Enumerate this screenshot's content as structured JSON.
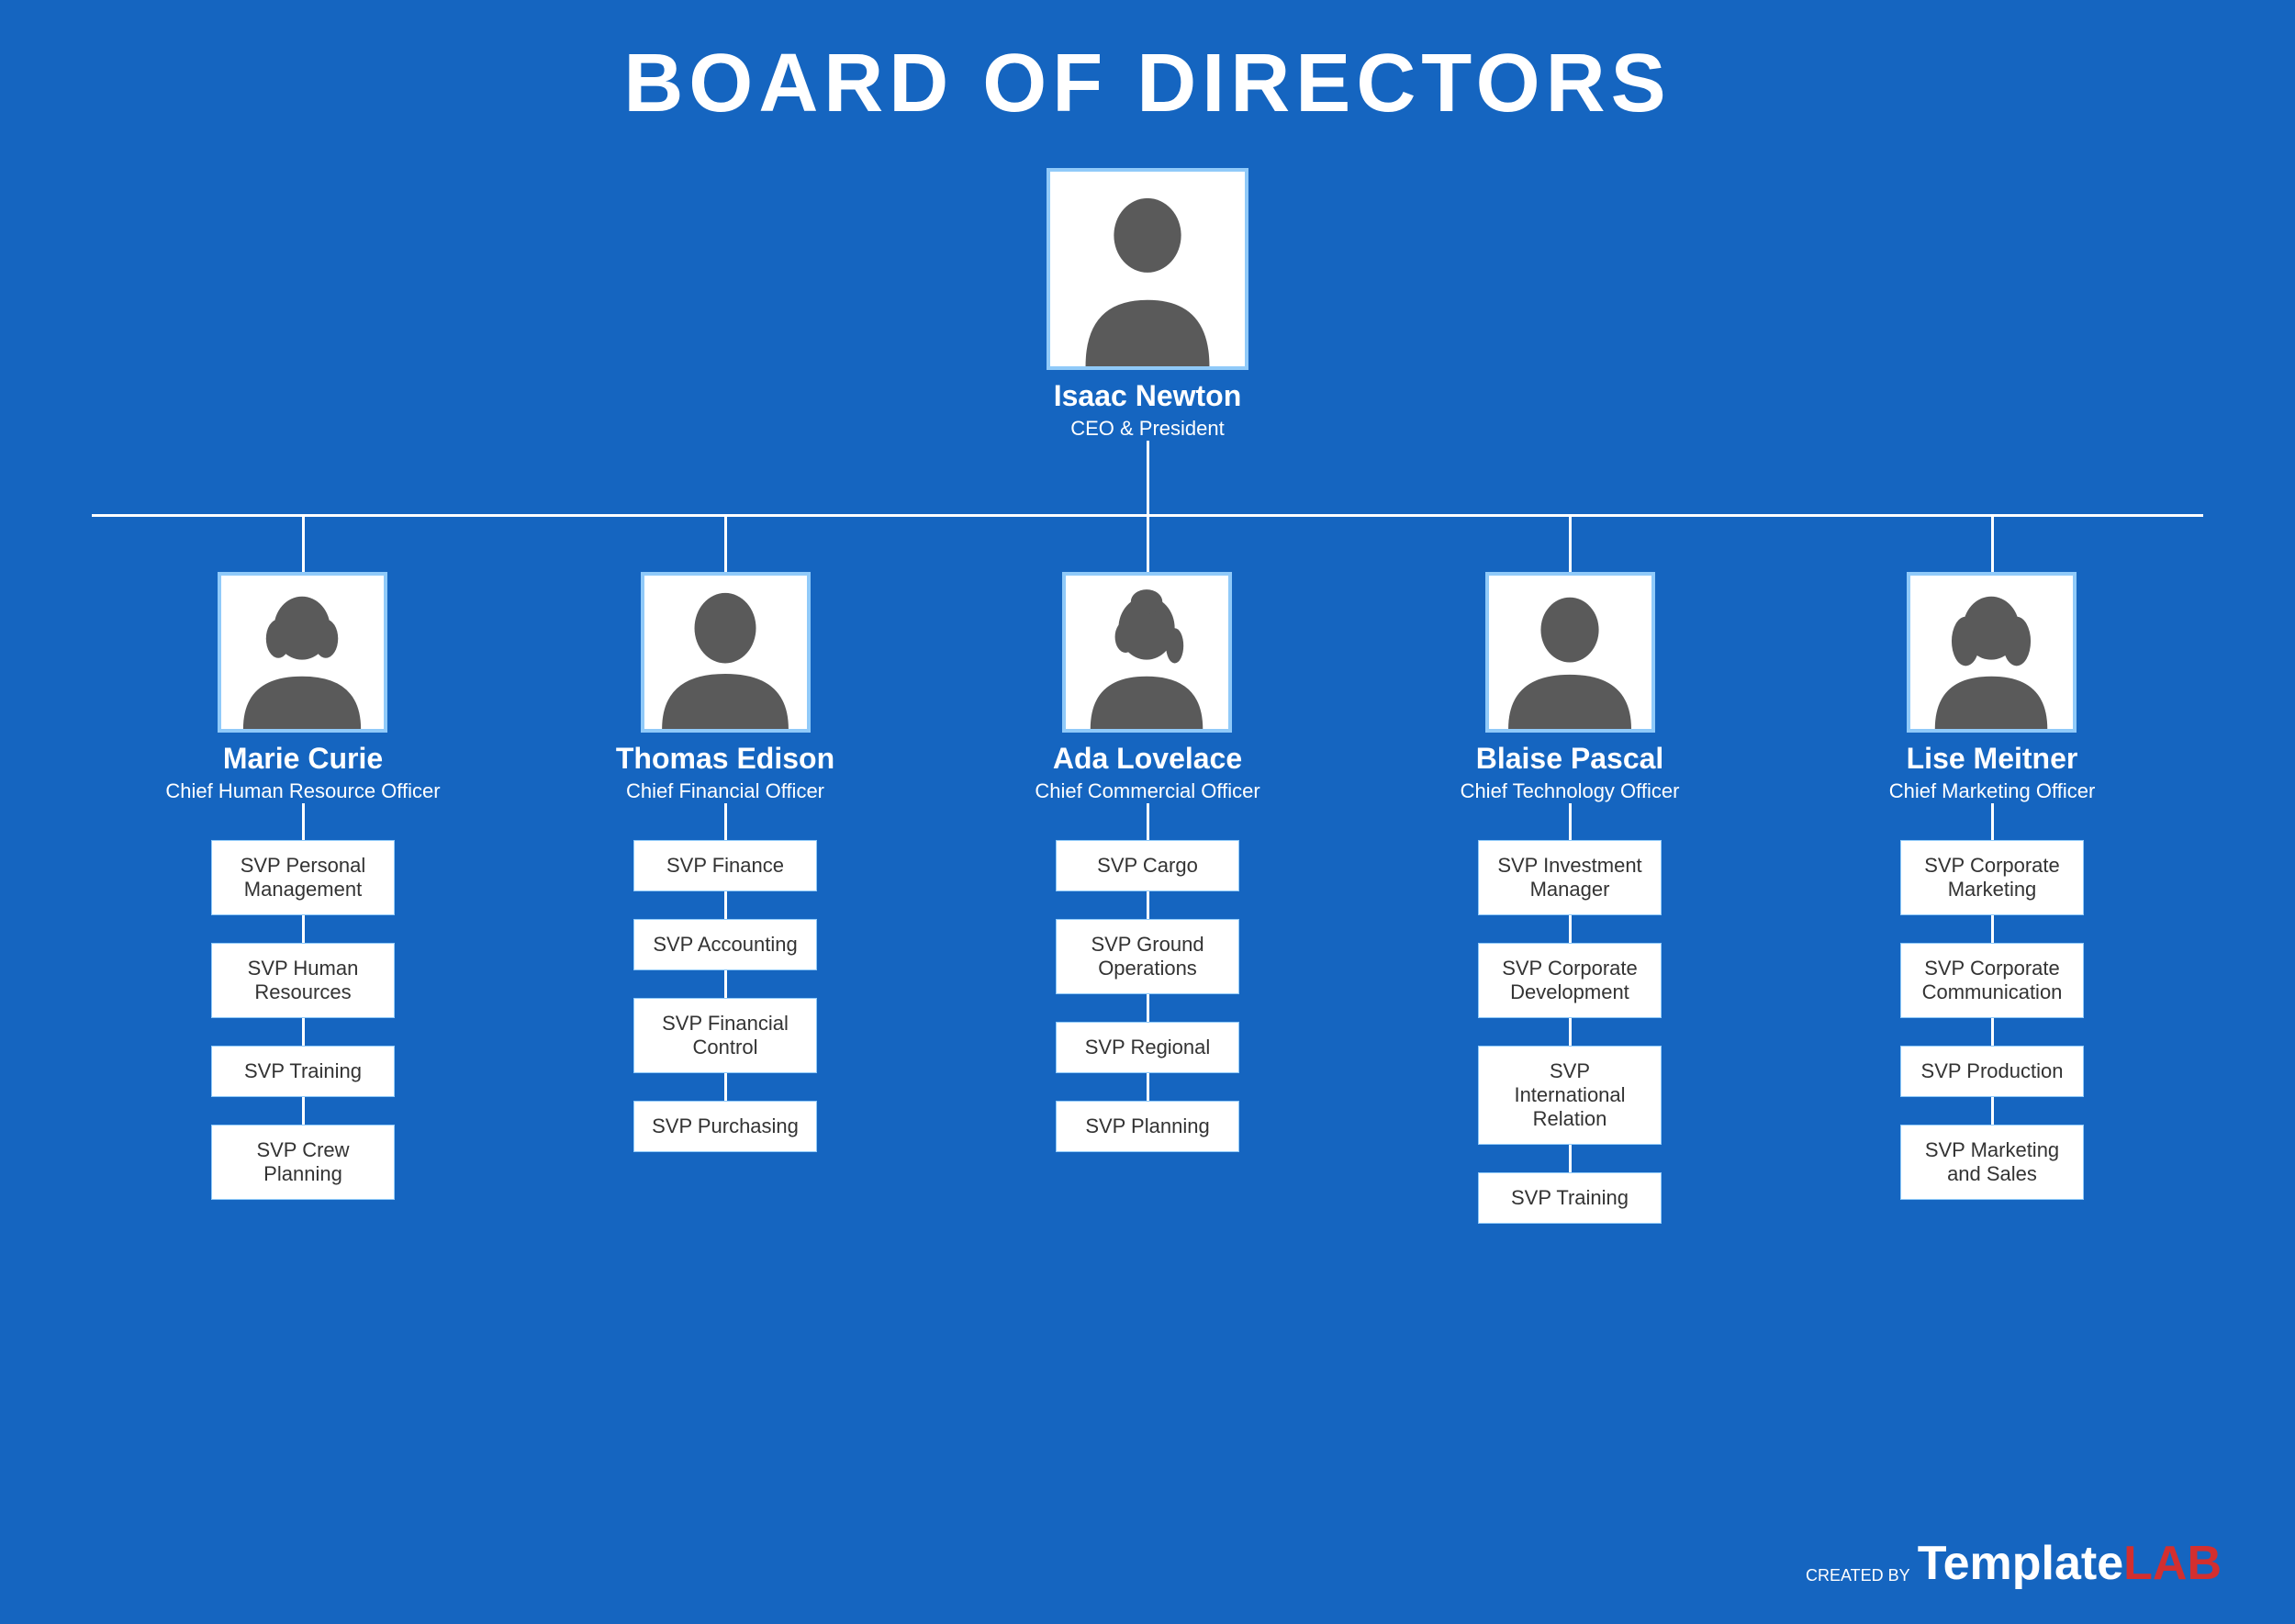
{
  "page": {
    "title": "BOARD OF DIRECTORS",
    "background_color": "#1565C0"
  },
  "ceo": {
    "name": "Isaac Newton",
    "role": "CEO & President"
  },
  "columns": [
    {
      "name": "Marie Curie",
      "role": "Chief Human Resource Officer",
      "gender": "female",
      "svps": [
        "SVP Personal Management",
        "SVP Human Resources",
        "SVP Training",
        "SVP Crew Planning"
      ]
    },
    {
      "name": "Thomas Edison",
      "role": "Chief Financial Officer",
      "gender": "male",
      "svps": [
        "SVP Finance",
        "SVP Accounting",
        "SVP Financial Control",
        "SVP Purchasing"
      ]
    },
    {
      "name": "Ada Lovelace",
      "role": "Chief Commercial Officer",
      "gender": "female2",
      "svps": [
        "SVP Cargo",
        "SVP Ground Operations",
        "SVP Regional",
        "SVP Planning"
      ]
    },
    {
      "name": "Blaise Pascal",
      "role": "Chief Technology Officer",
      "gender": "male2",
      "svps": [
        "SVP Investment Manager",
        "SVP Corporate Development",
        "SVP International Relation",
        "SVP Training"
      ]
    },
    {
      "name": "Lise Meitner",
      "role": "Chief Marketing Officer",
      "gender": "female",
      "svps": [
        "SVP Corporate Marketing",
        "SVP Corporate Communication",
        "SVP Production",
        "SVP Marketing and Sales"
      ]
    }
  ],
  "logo": {
    "created_by": "CREATED BY",
    "template": "Template",
    "lab": "LAB"
  }
}
